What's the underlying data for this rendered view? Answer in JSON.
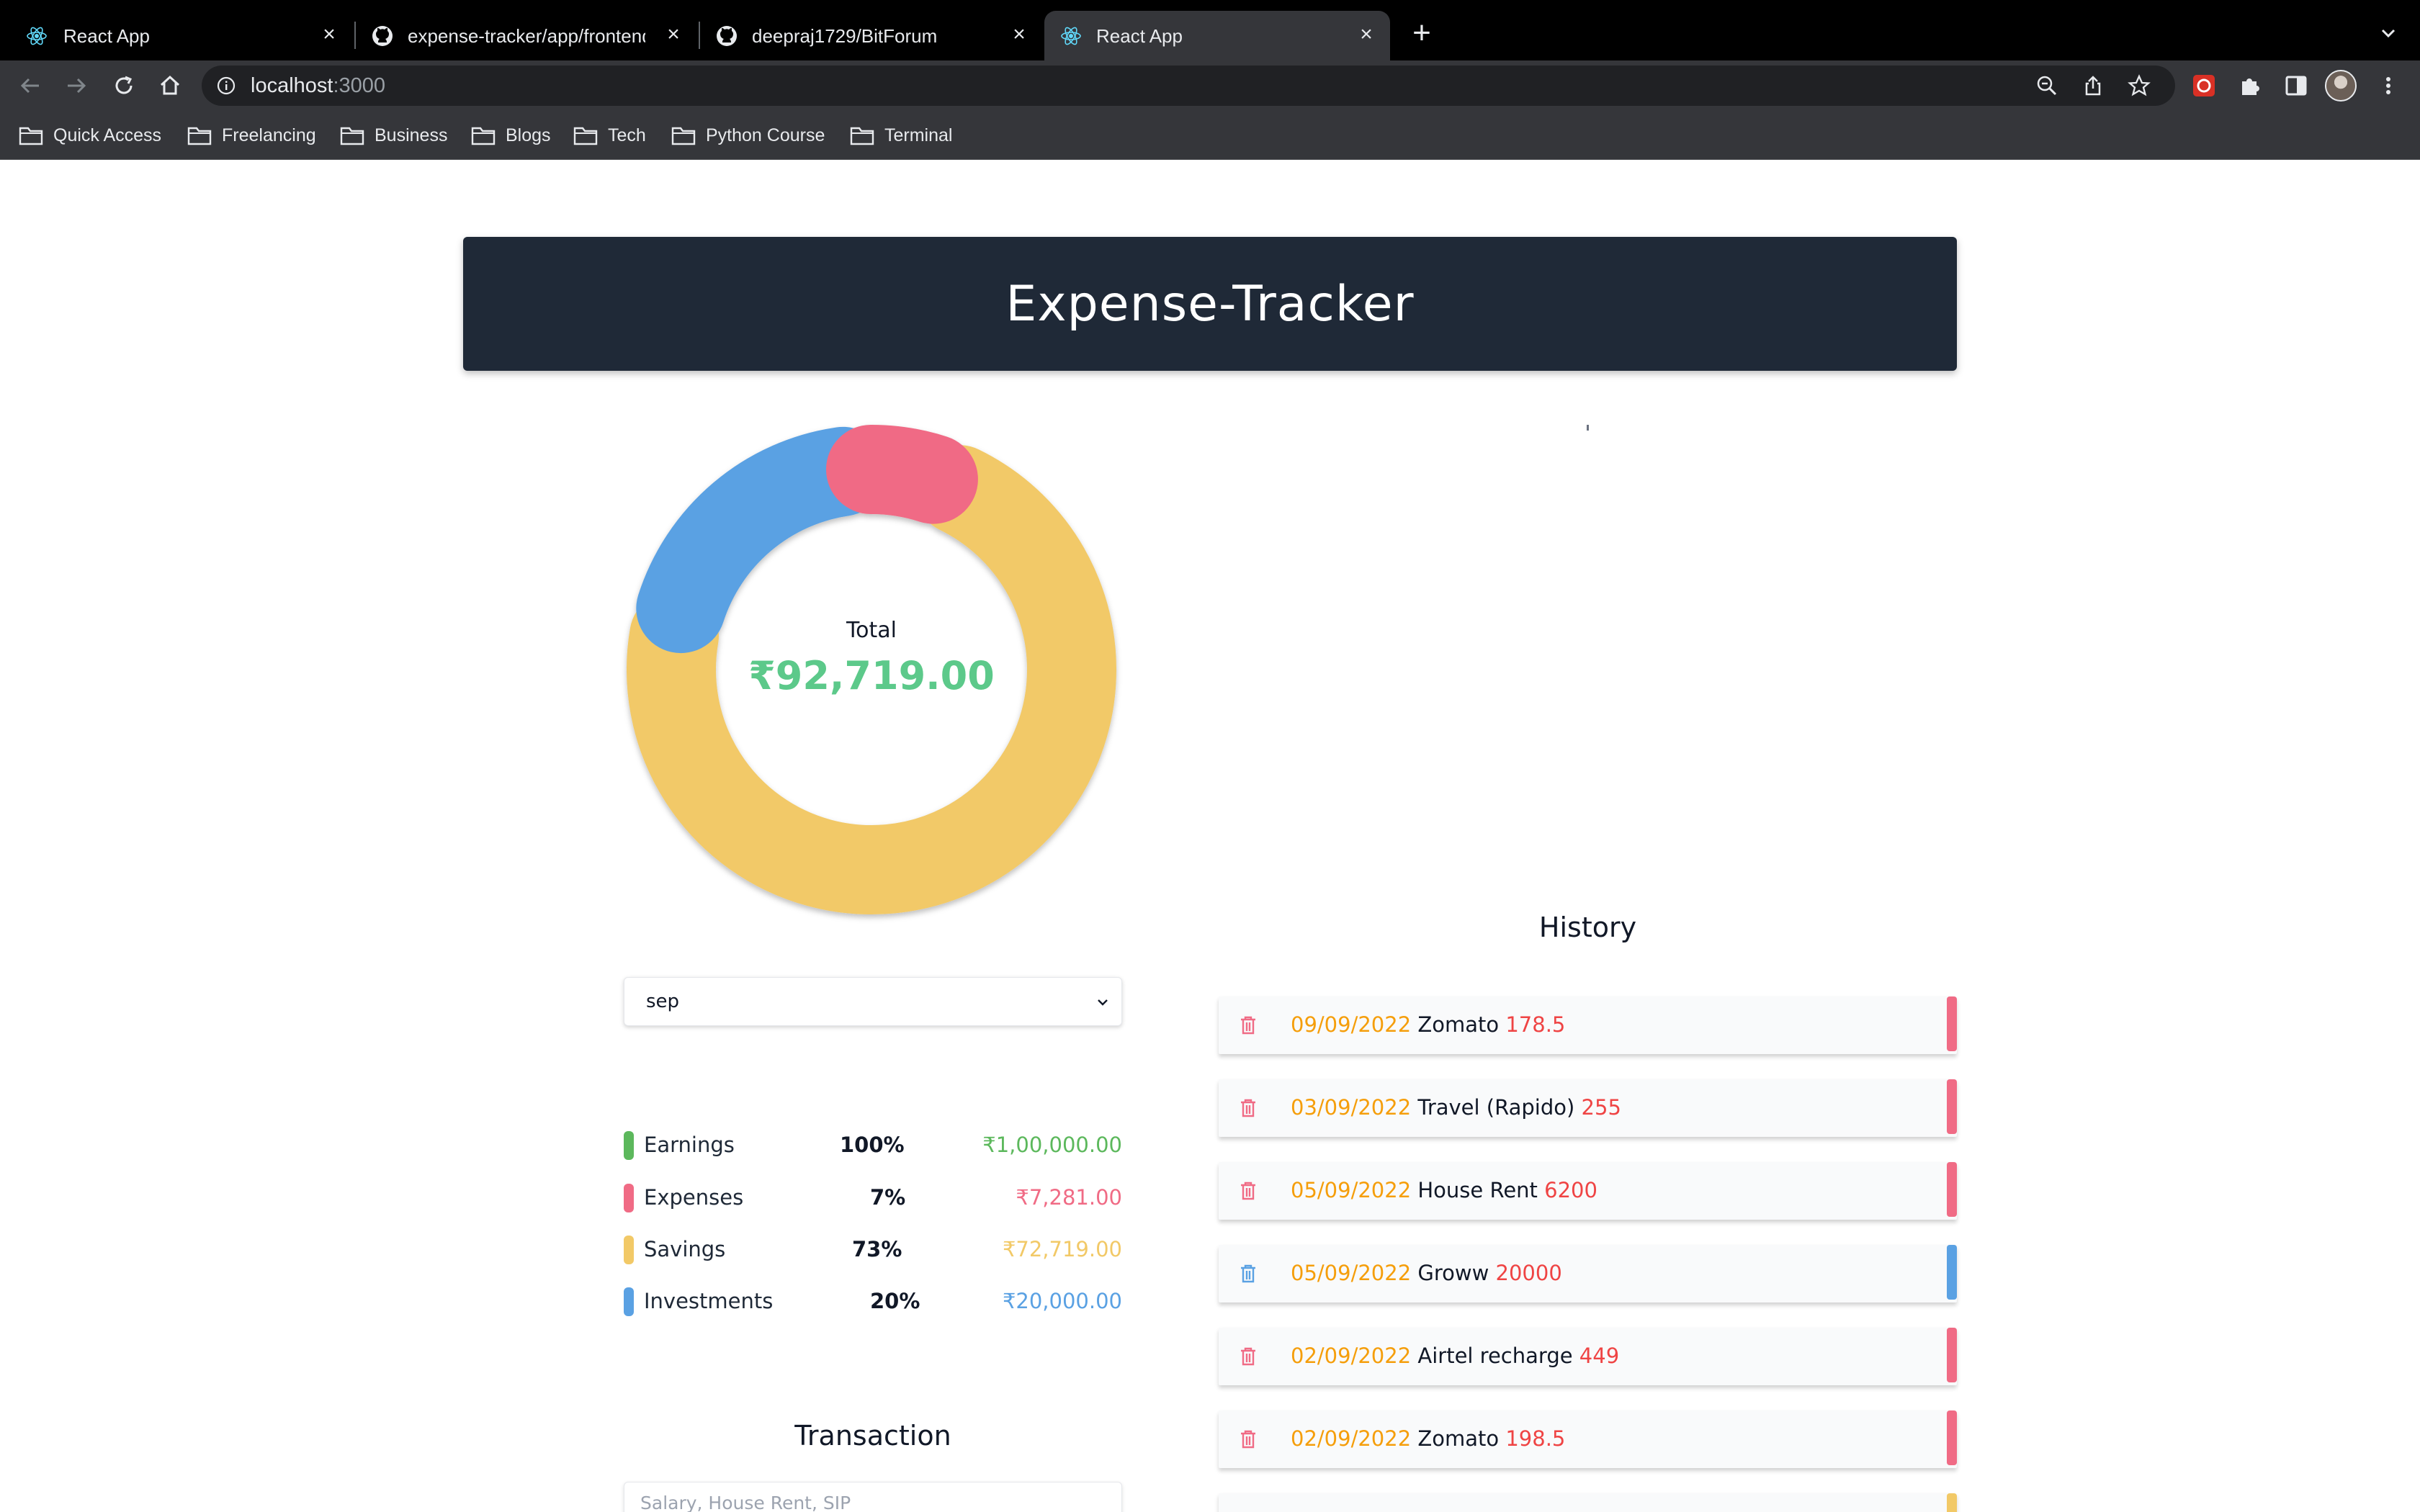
{
  "browser": {
    "tabs": [
      {
        "title": "React App",
        "icon": "react-icon",
        "active": false
      },
      {
        "title": "expense-tracker/app/frontend",
        "icon": "github-icon",
        "active": false
      },
      {
        "title": "deepraj1729/BitForum",
        "icon": "github-icon",
        "active": false
      },
      {
        "title": "React App",
        "icon": "react-icon",
        "active": true
      }
    ],
    "url_host": "localhost",
    "url_port": ":3000",
    "bookmarks": [
      "Quick Access",
      "Freelancing",
      "Business",
      "Blogs",
      "Tech",
      "Python Course",
      "Terminal"
    ]
  },
  "app": {
    "title": "Expense-Tracker",
    "total_label": "Total",
    "total_value": "₹92,719.00",
    "month_select": "sep",
    "transaction_title": "Transaction",
    "transaction_placeholder": "Salary, House Rent, SIP",
    "history_title": "History"
  },
  "colors": {
    "earnings": "#5cb85c",
    "expenses": "#f06b85",
    "savings": "#f2c967",
    "investments": "#5aa1e3",
    "header_bg": "#1f2937",
    "total_green": "#5cc98a"
  },
  "chart_data": {
    "type": "pie",
    "title": "",
    "categories": [
      "Savings",
      "Investments",
      "Expenses"
    ],
    "values": [
      72719,
      20000,
      7281
    ],
    "percentages": [
      73,
      20,
      7
    ]
  },
  "legend": [
    {
      "label": "Earnings",
      "percent": "100%",
      "amount": "₹1,00,000.00",
      "color": "#5cb85c"
    },
    {
      "label": "Expenses",
      "percent": "7%",
      "amount": "₹7,281.00",
      "color": "#f06b85"
    },
    {
      "label": "Savings",
      "percent": "73%",
      "amount": "₹72,719.00",
      "color": "#f2c967"
    },
    {
      "label": "Investments",
      "percent": "20%",
      "amount": "₹20,000.00",
      "color": "#5aa1e3"
    }
  ],
  "history": [
    {
      "date": "09/09/2022",
      "name": "Zomato",
      "amount": "178.5",
      "color": "#f06b85"
    },
    {
      "date": "03/09/2022",
      "name": "Travel (Rapido)",
      "amount": "255",
      "color": "#f06b85"
    },
    {
      "date": "05/09/2022",
      "name": "House Rent",
      "amount": "6200",
      "color": "#f06b85"
    },
    {
      "date": "05/09/2022",
      "name": "Groww",
      "amount": "20000",
      "color": "#5aa1e3"
    },
    {
      "date": "02/09/2022",
      "name": "Airtel recharge",
      "amount": "449",
      "color": "#f06b85"
    },
    {
      "date": "02/09/2022",
      "name": "Zomato",
      "amount": "198.5",
      "color": "#f06b85"
    }
  ]
}
